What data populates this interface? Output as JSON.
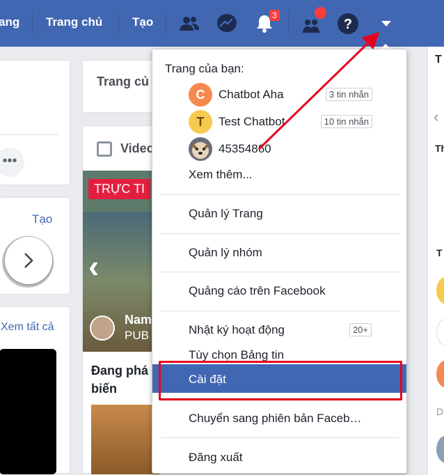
{
  "topbar": {
    "partial_left_label": "ang",
    "home_label": "Trang chủ",
    "create_label": "Tạo",
    "notification_count": "3",
    "colors": {
      "bar": "#4267b2",
      "badge": "#fa3e3e"
    }
  },
  "background": {
    "pages_card_title": "Trang củ",
    "create_link": "Tạo",
    "videos_title": "Videc",
    "live_badge": "TRỰC TI",
    "streamer_name": "Nam",
    "streamer_sub": "PUB",
    "trending_text": "Đang phá\nbiến",
    "see_all_link": "Xem tất cả",
    "right_col_letters": [
      "T",
      "Th",
      "T",
      "D"
    ]
  },
  "dropdown": {
    "heading": "Trang của bạn:",
    "pages": [
      {
        "name": "Chatbot Aha",
        "initial": "C",
        "avatar_color": "#f5894f",
        "count": "3 tin nhắn"
      },
      {
        "name": "Test Chatbot",
        "initial": "T",
        "avatar_color": "#f7c94e",
        "count": "10 tin nhắn"
      },
      {
        "name": "45354860",
        "initial": "",
        "avatar_color": "#6b6b7b",
        "count": ""
      }
    ],
    "see_more": "Xem thêm...",
    "items": {
      "manage_pages": "Quản lý Trang",
      "manage_groups": "Quản lý nhóm",
      "ads": "Quảng cáo trên Facebook",
      "activity_log": "Nhật ký hoạt động",
      "activity_count": "20+",
      "news_feed_prefs": "Tùy chọn Bảng tin",
      "settings": "Cài đặt",
      "switch_version": "Chuyển sang phiên bản Faceb…",
      "logout": "Đăng xuất"
    },
    "selected_color": "#4267b2"
  },
  "annotation": {
    "color": "#e8001c"
  }
}
